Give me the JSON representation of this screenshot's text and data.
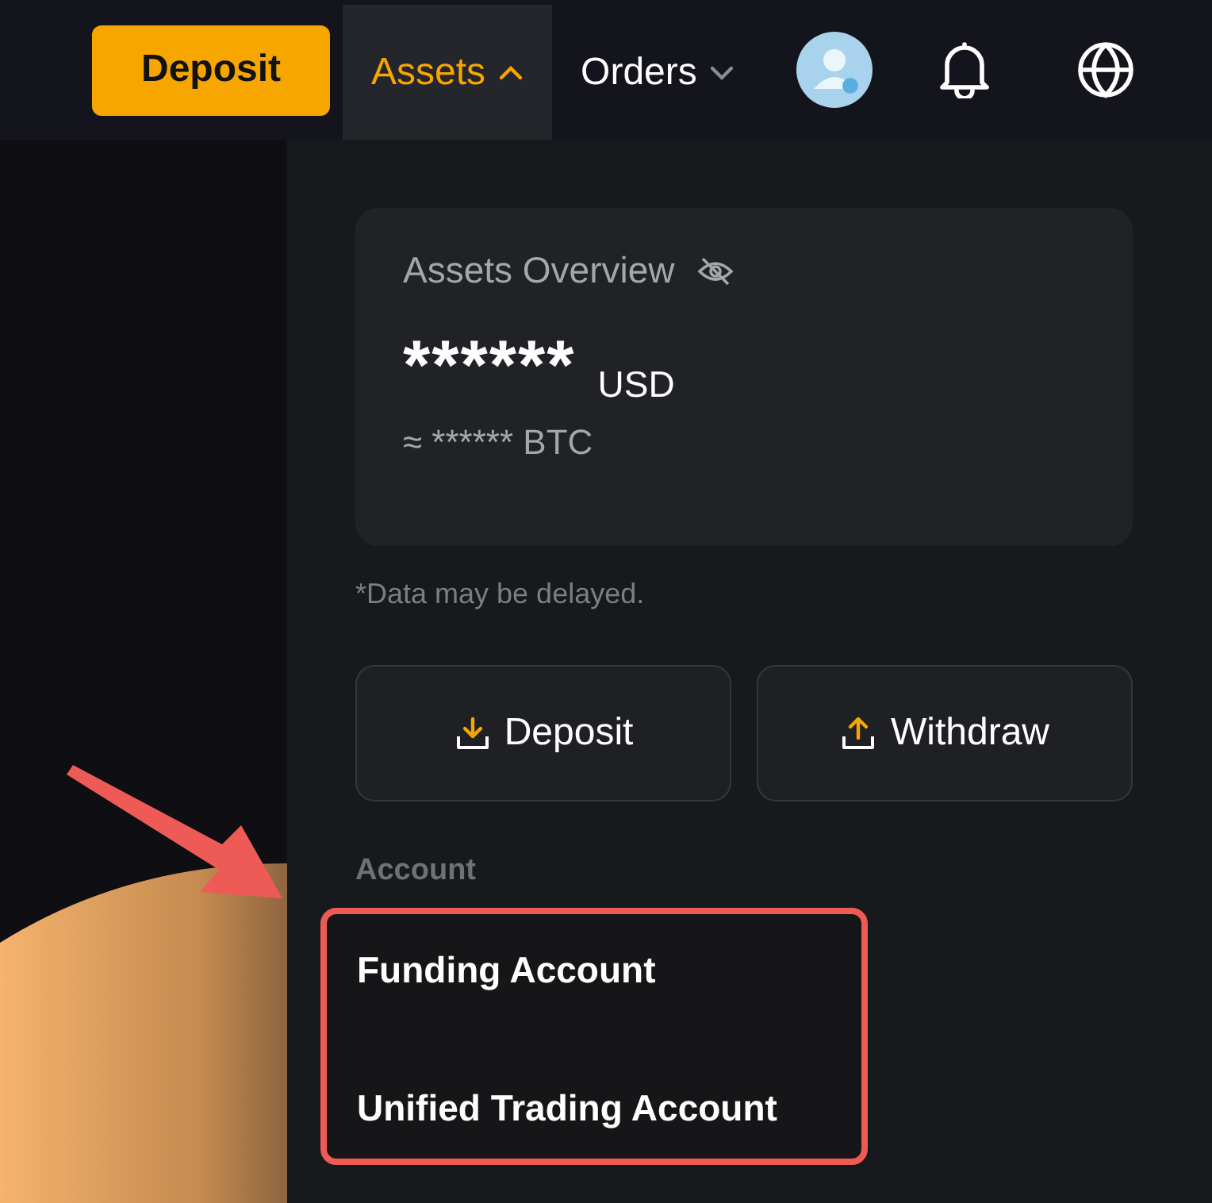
{
  "top_bar": {
    "deposit_button": "Deposit",
    "nav_items": [
      {
        "label": "Assets",
        "selected": true,
        "expanded": true
      },
      {
        "label": "Orders",
        "selected": false,
        "expanded": false
      }
    ]
  },
  "assets_panel": {
    "overview": {
      "title": "Assets Overview",
      "balance": "******",
      "currency": "USD",
      "btc_line": "≈ ****** BTC"
    },
    "note": "*Data may be delayed.",
    "actions": [
      {
        "label": "Deposit",
        "kind": "download"
      },
      {
        "label": "Withdraw",
        "kind": "upload"
      }
    ],
    "account_heading": "Account",
    "accounts": [
      "Funding Account",
      "Unified Trading Account"
    ]
  }
}
